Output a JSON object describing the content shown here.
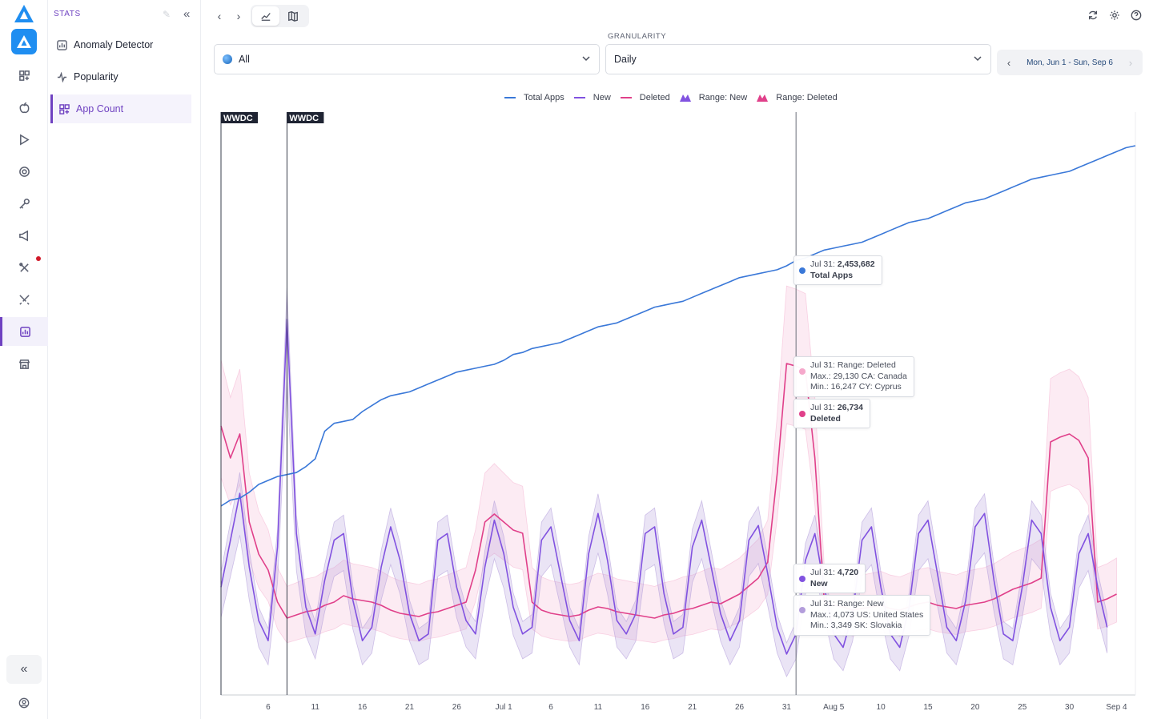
{
  "colors": {
    "accent": "#6f42c1",
    "total_apps": "#3a78d8",
    "new": "#8152e0",
    "deleted": "#e0408a",
    "range_new": "#b39ddb",
    "range_deleted": "#f5b8d4"
  },
  "rail": {
    "icons": [
      "app-logo-icon",
      "apps-grid-icon",
      "apple-icon",
      "play-store-icon",
      "target-icon",
      "key-icon",
      "megaphone-icon",
      "tools-icon",
      "swords-icon",
      "stats-icon",
      "store-icon"
    ],
    "collapse_icon": "double-chevron-left-icon",
    "user_icon": "user-icon"
  },
  "sidebar": {
    "heading": "STATS",
    "items": [
      {
        "label": "Anomaly Detector",
        "icon": "chart-box-icon"
      },
      {
        "label": "Popularity",
        "icon": "pulse-icon"
      },
      {
        "label": "App Count",
        "icon": "apps-grid-icon",
        "active": true
      }
    ]
  },
  "filters": {
    "country": {
      "value": "All",
      "icon": "globe-icon"
    },
    "granularity": {
      "label": "GRANULARITY",
      "value": "Daily"
    },
    "date_range": "Mon, Jun 1 - Sun, Sep 6"
  },
  "legend": [
    {
      "label": "Total Apps",
      "key": "total_apps",
      "kind": "line"
    },
    {
      "label": "New",
      "key": "new",
      "kind": "line"
    },
    {
      "label": "Deleted",
      "key": "deleted",
      "kind": "line"
    },
    {
      "label": "Range: New",
      "key": "range_new",
      "kind": "range"
    },
    {
      "label": "Range: Deleted",
      "key": "range_deleted",
      "kind": "range"
    }
  ],
  "tooltips": {
    "total": {
      "date": "Jul 31:",
      "value": "2,453,682",
      "series": "Total Apps"
    },
    "range_deleted": {
      "title": "Jul 31: Range: Deleted",
      "max": "Max.: 29,130 CA: Canada",
      "min": "Min.: 16,247 CY: Cyprus"
    },
    "deleted": {
      "date": "Jul 31:",
      "value": "26,734",
      "series": "Deleted"
    },
    "new": {
      "date": "Jul 31:",
      "value": "4,720",
      "series": "New"
    },
    "range_new": {
      "title": "Jul 31: Range: New",
      "max": "Max.: 4,073 US: United States",
      "min": "Min.: 3,349 SK: Slovakia"
    }
  },
  "chart_data": {
    "type": "line",
    "title": "",
    "xlabel": "",
    "ylabel": "",
    "x_tick_labels": [
      "6",
      "11",
      "16",
      "21",
      "26",
      "Jul 1",
      "6",
      "11",
      "16",
      "21",
      "26",
      "31",
      "Aug 5",
      "10",
      "15",
      "20",
      "25",
      "30",
      "Sep 4"
    ],
    "annotations": [
      {
        "label": "WWDC",
        "date": "Jun 1"
      },
      {
        "label": "WWDC",
        "date": "Jun 8"
      }
    ],
    "cursor_date": "Jul 31",
    "series": [
      {
        "name": "Total Apps",
        "key": "total_apps",
        "values": [
          1830000,
          1845000,
          1850000,
          1865000,
          1885000,
          1895000,
          1905000,
          1910000,
          1915000,
          1930000,
          1950000,
          2020000,
          2040000,
          2045000,
          2050000,
          2070000,
          2085000,
          2100000,
          2110000,
          2115000,
          2120000,
          2130000,
          2140000,
          2150000,
          2160000,
          2170000,
          2175000,
          2180000,
          2185000,
          2190000,
          2200000,
          2215000,
          2220000,
          2230000,
          2235000,
          2240000,
          2245000,
          2255000,
          2265000,
          2275000,
          2285000,
          2290000,
          2295000,
          2305000,
          2315000,
          2325000,
          2335000,
          2340000,
          2345000,
          2350000,
          2360000,
          2370000,
          2380000,
          2390000,
          2400000,
          2410000,
          2415000,
          2420000,
          2425000,
          2430000,
          2440000,
          2453682,
          2460000,
          2470000,
          2480000,
          2485000,
          2490000,
          2495000,
          2500000,
          2510000,
          2520000,
          2530000,
          2540000,
          2550000,
          2555000,
          2560000,
          2570000,
          2580000,
          2590000,
          2600000,
          2605000,
          2610000,
          2620000,
          2630000,
          2640000,
          2650000,
          2660000,
          2665000,
          2670000,
          2675000,
          2680000,
          2690000,
          2700000,
          2710000,
          2720000,
          2730000,
          2740000,
          2745000
        ]
      },
      {
        "name": "New",
        "key": "new",
        "values": [
          3800,
          4500,
          5200,
          4100,
          3300,
          3000,
          4400,
          7800,
          4600,
          3500,
          3100,
          3900,
          4500,
          4600,
          3600,
          3000,
          3200,
          4100,
          4700,
          4200,
          3400,
          3000,
          3100,
          4500,
          4600,
          3800,
          3300,
          3100,
          4100,
          4800,
          4300,
          3500,
          3100,
          3200,
          4500,
          4700,
          4000,
          3300,
          3000,
          4300,
          4900,
          4200,
          3300,
          3100,
          3400,
          4600,
          4700,
          3700,
          3100,
          3200,
          4400,
          4800,
          4100,
          3400,
          3000,
          3300,
          4500,
          4720,
          4000,
          3200,
          2800,
          3100,
          4200,
          4600,
          3800,
          3100,
          2900,
          3400,
          4500,
          4700,
          3800,
          3100,
          2900,
          3500,
          4600,
          4800,
          4000,
          3200,
          3000,
          3600,
          4700,
          4900,
          3900,
          3100,
          3000,
          3800,
          4800,
          4600,
          3500,
          3000,
          3200,
          4300,
          4600,
          3800,
          3200
        ]
      },
      {
        "name": "Deleted",
        "key": "deleted",
        "values": [
          23000,
          21000,
          22500,
          17000,
          15000,
          14000,
          12000,
          11000,
          11200,
          11400,
          11500,
          11800,
          12000,
          12400,
          12200,
          12100,
          12000,
          11800,
          11500,
          11300,
          11200,
          11100,
          11300,
          11400,
          11600,
          11800,
          12000,
          14000,
          17000,
          17500,
          17000,
          16500,
          16300,
          12000,
          11500,
          11300,
          11200,
          11100,
          11200,
          11500,
          11700,
          11600,
          11400,
          11300,
          11200,
          11100,
          11000,
          11200,
          11300,
          11500,
          11600,
          11800,
          12000,
          11900,
          12200,
          12500,
          13000,
          13500,
          14500,
          20000,
          26900,
          26734,
          26500,
          21000,
          12000,
          11800,
          11700,
          11500,
          11600,
          11700,
          11800,
          11600,
          11500,
          11700,
          11900,
          12000,
          11800,
          11700,
          11600,
          11800,
          11900,
          12000,
          12200,
          12500,
          12800,
          13000,
          13200,
          13500,
          22000,
          22300,
          22500,
          22100,
          21000,
          12000,
          12200,
          12500
        ]
      }
    ]
  }
}
